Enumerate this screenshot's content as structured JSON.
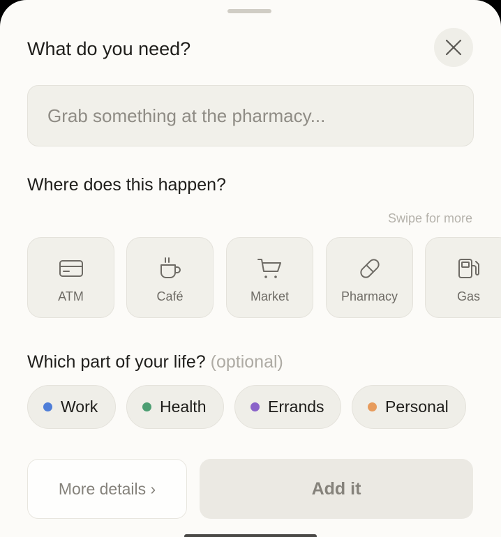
{
  "sheet": {
    "title": "What do you need?",
    "close_icon": "x-icon"
  },
  "task": {
    "placeholder": "Grab something at the pharmacy...",
    "value": ""
  },
  "places": {
    "heading": "Where does this happen?",
    "hint": "Swipe for more",
    "items": [
      {
        "label": "ATM",
        "icon": "credit-card-icon"
      },
      {
        "label": "Café",
        "icon": "coffee-cup-icon"
      },
      {
        "label": "Market",
        "icon": "shopping-cart-icon"
      },
      {
        "label": "Pharmacy",
        "icon": "pill-icon"
      },
      {
        "label": "Gas",
        "icon": "fuel-pump-icon"
      }
    ]
  },
  "life": {
    "heading": "Which part of your life?",
    "optional": "(optional)",
    "chips": [
      {
        "label": "Work",
        "color": "#4f7ed8"
      },
      {
        "label": "Health",
        "color": "#4d9e72"
      },
      {
        "label": "Errands",
        "color": "#8a63c9"
      },
      {
        "label": "Personal",
        "color": "#e79b5c"
      }
    ]
  },
  "actions": {
    "more_label": "More details ›",
    "add_label": "Add it"
  }
}
